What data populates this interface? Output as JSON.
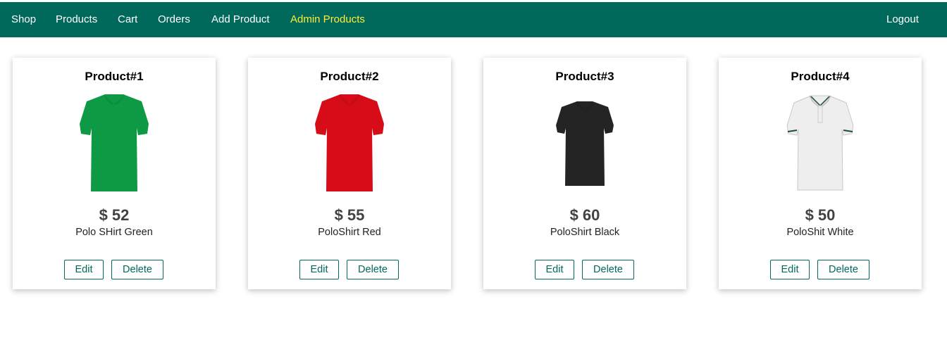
{
  "nav": {
    "items": [
      {
        "label": "Shop"
      },
      {
        "label": "Products"
      },
      {
        "label": "Cart"
      },
      {
        "label": "Orders"
      },
      {
        "label": "Add Product"
      },
      {
        "label": "Admin Products"
      }
    ],
    "logout": "Logout",
    "active_item": "Admin Products"
  },
  "colors": {
    "navbar": "#00695c",
    "active_nav": "#ffeb3b",
    "button_border": "#00695c"
  },
  "products": [
    {
      "title": "Product#1",
      "price": "$ 52",
      "description": "Polo SHirt Green",
      "edit_label": "Edit",
      "delete_label": "Delete",
      "shirt_color": "#0e9a45",
      "image_icon": "green-polo-shirt-image"
    },
    {
      "title": "Product#2",
      "price": "$ 55",
      "description": "PoloShirt Red",
      "edit_label": "Edit",
      "delete_label": "Delete",
      "shirt_color": "#d60d18",
      "image_icon": "red-polo-shirt-image"
    },
    {
      "title": "Product#3",
      "price": "$ 60",
      "description": "PoloShirt Black",
      "edit_label": "Edit",
      "delete_label": "Delete",
      "shirt_color": "#242424",
      "image_icon": "black-polo-shirt-image"
    },
    {
      "title": "Product#4",
      "price": "$ 50",
      "description": "PoloShit White",
      "edit_label": "Edit",
      "delete_label": "Delete",
      "shirt_color": "#eeeeee",
      "image_icon": "white-polo-shirt-image"
    }
  ]
}
